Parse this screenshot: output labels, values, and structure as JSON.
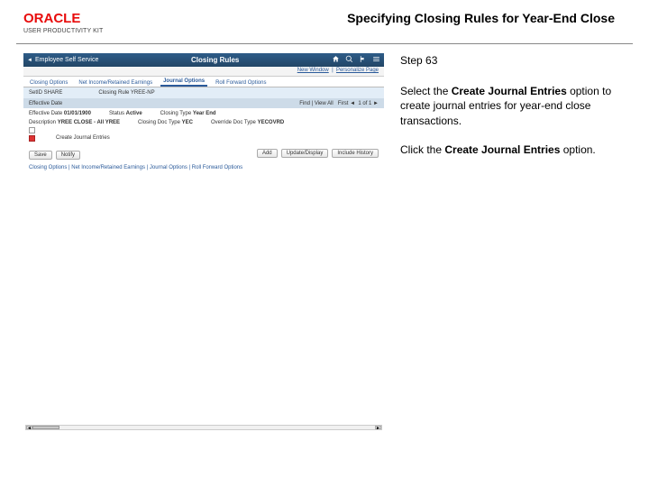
{
  "logo": {
    "brand": "ORACLE",
    "kit": "USER PRODUCTIVITY KIT"
  },
  "page_title": "Specifying Closing Rules for Year-End Close",
  "instructions": {
    "step_label": "Step 63",
    "para1_pre": "Select the ",
    "para1_bold": "Create Journal Entries",
    "para1_post": " option to create journal entries for year-end close transactions.",
    "para2_pre": "Click the ",
    "para2_bold": "Create Journal Entries",
    "para2_post": " option."
  },
  "screenshot": {
    "topbar": {
      "back": "◄",
      "section": "Employee Self Service",
      "title": "Closing Rules"
    },
    "subbar": {
      "newwindow": "New Window",
      "personalize": "Personalize Page"
    },
    "tabs": [
      "Closing Options",
      "Net Income/Retained Earnings",
      "Journal Options",
      "Roll Forward Options"
    ],
    "active_tab": 2,
    "header_row": {
      "setid": "SetID  SHARE",
      "rule": "Closing Rule  YREE-NP"
    },
    "eff_row": {
      "label": "Effective Date",
      "find": "Find | View All",
      "first": "First",
      "count": "1 of 1"
    },
    "body": {
      "eff_date": {
        "label": "Effective Date",
        "val": "01/01/1900"
      },
      "status": {
        "label": "Status",
        "val": "Active"
      },
      "desc": {
        "label": "Description",
        "val": "YREE CLOSE - All YREE"
      },
      "closing_type": {
        "label": "Closing Type",
        "val": "Year End"
      },
      "closing_doc": {
        "label": "Closing Doc Type",
        "val": "YEC"
      },
      "override_doc": {
        "label": "Override Doc Type",
        "val": "YECOVRD"
      },
      "create_journal": "Create Journal Entries"
    },
    "buttons": {
      "save": "Save",
      "notify": "Notify"
    },
    "right_info": {
      "add": "Add",
      "update": "Update/Display",
      "include": "Include History"
    },
    "bottom_links": "Closing Options | Net Income/Retained Earnings | Journal Options | Roll Forward Options"
  }
}
